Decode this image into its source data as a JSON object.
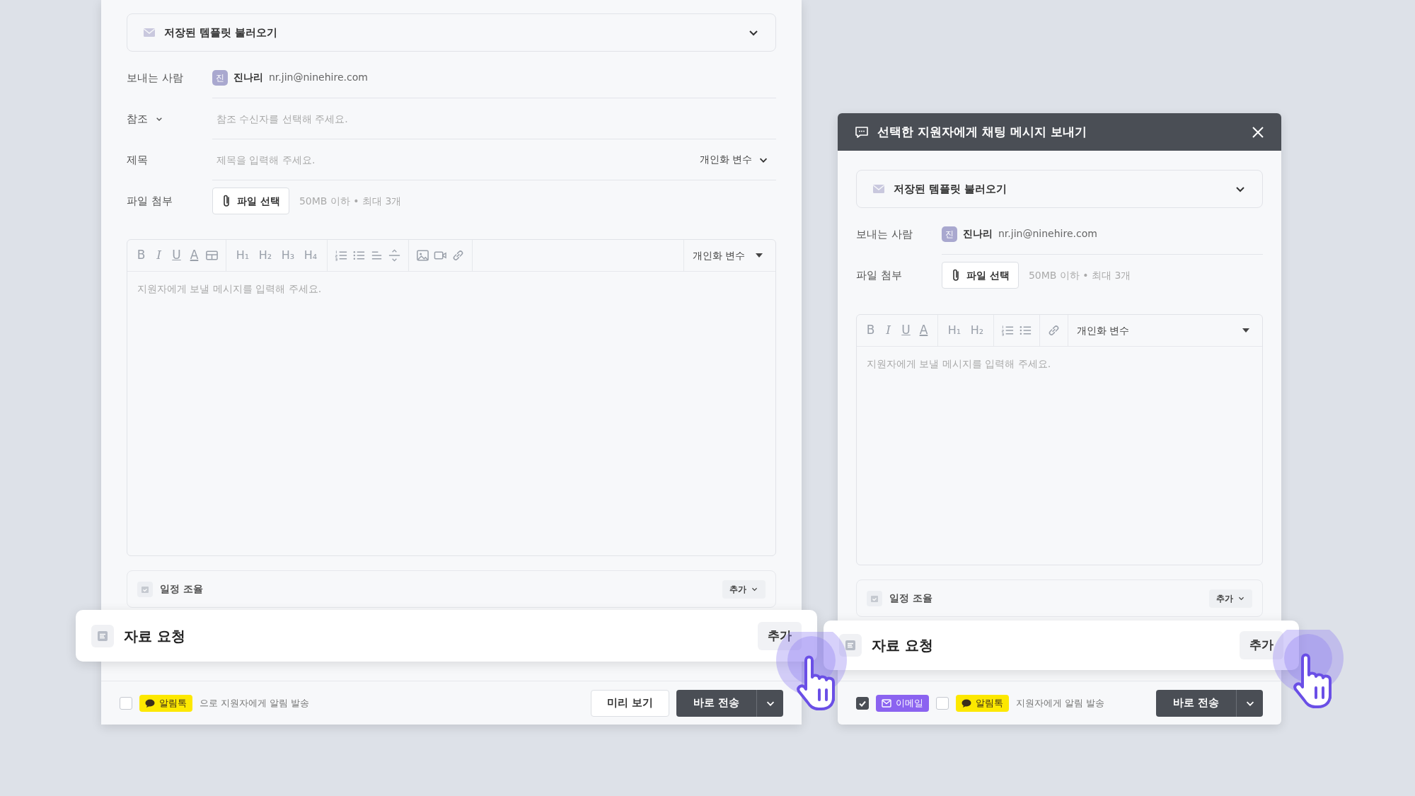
{
  "panels": [
    {
      "kind": "email",
      "template_loader": {
        "label": "저장된 템플릿 불러오기"
      },
      "fields": [
        {
          "kind": "sender",
          "label": "보내는 사람",
          "avatar": "진",
          "name": "진나리",
          "email": "nr.jin@ninehire.com"
        },
        {
          "kind": "cc",
          "label": "참조",
          "placeholder": "참조 수신자를 선택해 주세요."
        },
        {
          "kind": "subject",
          "label": "제목",
          "placeholder": "제목을 입력해 주세요.",
          "variables_label": "개인화 변수"
        },
        {
          "kind": "attachment",
          "label": "파일 첨부",
          "button": "파일 선택",
          "hint": "50MB 이하 • 최대 3개"
        }
      ],
      "editor": {
        "toolbar": [
          [
            {
              "kind": "bold",
              "text": "B"
            },
            {
              "kind": "italic",
              "text": "I"
            },
            {
              "kind": "underline",
              "text": "U"
            },
            {
              "kind": "text-color",
              "text": "A"
            },
            {
              "kind": "table"
            }
          ],
          [
            {
              "kind": "heading",
              "text": "H₁"
            },
            {
              "kind": "heading",
              "text": "H₂"
            },
            {
              "kind": "heading",
              "text": "H₃"
            },
            {
              "kind": "heading",
              "text": "H₄"
            }
          ],
          [
            {
              "kind": "ordered-list"
            },
            {
              "kind": "bullet-list"
            },
            {
              "kind": "align"
            },
            {
              "kind": "divider"
            }
          ],
          [
            {
              "kind": "image"
            },
            {
              "kind": "video"
            },
            {
              "kind": "link"
            }
          ]
        ],
        "variables_label": "개인화 변수",
        "placeholder": "지원자에게 보낼 메시지를 입력해 주세요."
      },
      "schedule": {
        "label": "일정 조율",
        "add_button": "추가"
      },
      "request": {
        "label": "자료 요청",
        "add_button": "추가"
      },
      "footer": {
        "channels": [
          {
            "kind": "alimtalk",
            "label": "알림톡",
            "checked": false
          }
        ],
        "notify_text": "으로 지원자에게 알림 발송",
        "preview_button": "미리 보기",
        "send_button": "바로 전송"
      }
    },
    {
      "kind": "chat",
      "header": {
        "title": "선택한 지원자에게 채팅 메시지 보내기"
      },
      "template_loader": {
        "label": "저장된 템플릿 불러오기"
      },
      "fields": [
        {
          "kind": "sender",
          "label": "보내는 사람",
          "avatar": "진",
          "name": "진나리",
          "email": "nr.jin@ninehire.com"
        },
        {
          "kind": "attachment",
          "label": "파일 첨부",
          "button": "파일 선택",
          "hint": "50MB 이하 • 최대 3개"
        }
      ],
      "editor": {
        "toolbar": [
          [
            {
              "kind": "bold",
              "text": "B"
            },
            {
              "kind": "italic",
              "text": "I"
            },
            {
              "kind": "underline",
              "text": "U"
            },
            {
              "kind": "text-color",
              "text": "A"
            }
          ],
          [
            {
              "kind": "heading",
              "text": "H₁"
            },
            {
              "kind": "heading",
              "text": "H₂"
            }
          ],
          [
            {
              "kind": "ordered-list"
            },
            {
              "kind": "bullet-list"
            }
          ],
          [
            {
              "kind": "link"
            }
          ]
        ],
        "variables_label": "개인화 변수",
        "placeholder": "지원자에게 보낼 메시지를 입력해 주세요."
      },
      "schedule": {
        "label": "일정 조율",
        "add_button": "추가"
      },
      "request": {
        "label": "자료 요청",
        "add_button": "추가"
      },
      "footer": {
        "channels": [
          {
            "kind": "email",
            "label": "이메일",
            "checked": true
          },
          {
            "kind": "alimtalk",
            "label": "알림톡",
            "checked": false
          }
        ],
        "notify_text": "지원자에게 알림 발송",
        "send_button": "바로 전송"
      }
    }
  ]
}
